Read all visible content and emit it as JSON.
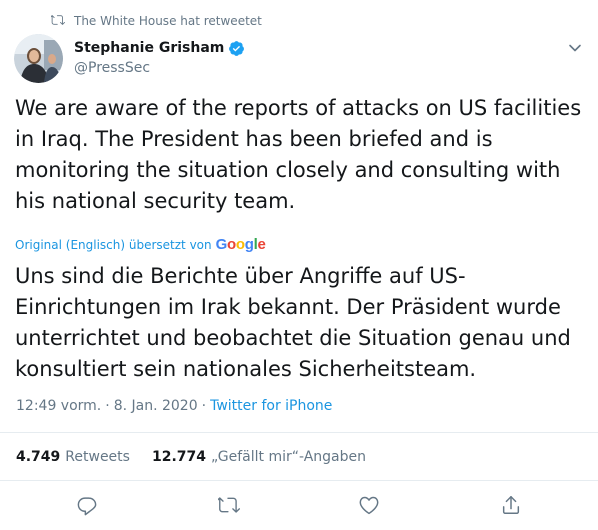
{
  "retweet_banner": {
    "icon": "retweet-icon",
    "text": "The White House hat retweetet"
  },
  "author": {
    "name": "Stephanie Grisham",
    "handle": "@PressSec",
    "verified_icon": "verified-badge-icon"
  },
  "tweet": {
    "text": "We are aware of the reports of attacks on US facilities in Iraq. The President has been briefed and is monitoring the situation closely and consulting with his national security team.",
    "translation_label": "Original (Englisch) übersetzt von",
    "translation_provider": "Google",
    "translated_text": "Uns sind die Berichte über Angriffe auf US-Einrichtungen im Irak bekannt. Der Präsident wurde unterrichtet und beobachtet die Situation genau und konsultiert sein nationales Sicherheitsteam."
  },
  "meta": {
    "time": "12:49 vorm.",
    "separator": "·",
    "date": "8. Jan. 2020",
    "source": "Twitter for iPhone"
  },
  "stats": {
    "retweets_count": "4.749",
    "retweets_label": "Retweets",
    "likes_count": "12.774",
    "likes_label": "„Gefällt mir“-Angaben"
  },
  "actions": [
    "reply-icon",
    "retweet-icon",
    "like-icon",
    "share-icon"
  ],
  "colors": {
    "accent": "#1b95e0",
    "secondary_text": "#657786",
    "primary_text": "#14171a",
    "divider": "#e6ecf0"
  }
}
